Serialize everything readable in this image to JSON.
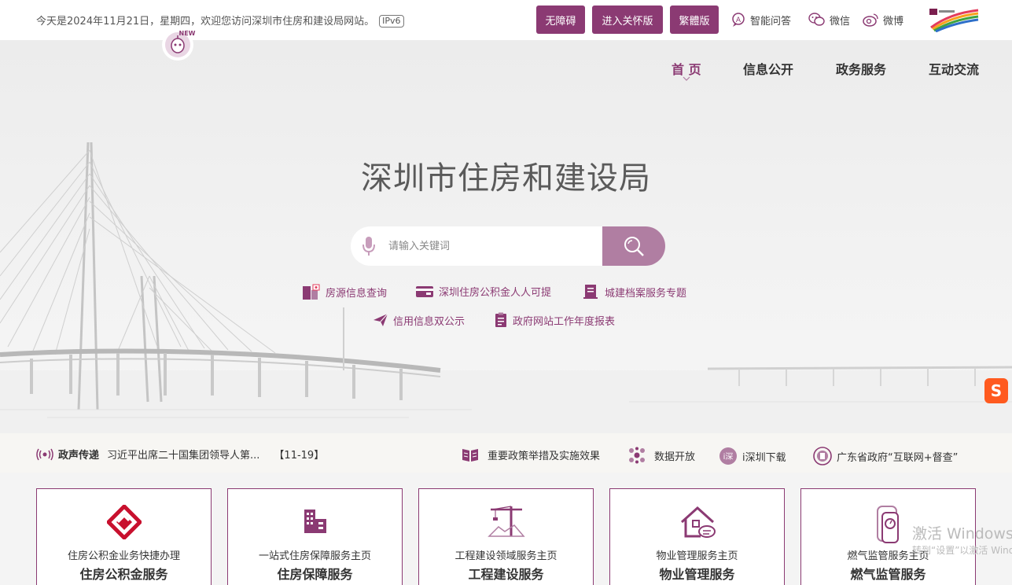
{
  "topbar": {
    "welcome": "今天是2024年11月21日，星期四，欢迎您访问深圳市住房和建设局网站。",
    "ipv6": "IPv6",
    "buttons": [
      "无障碍",
      "进入关怀版",
      "繁體版"
    ],
    "links": [
      "智能问答",
      "微信",
      "微博"
    ],
    "robot_badge": "NEW"
  },
  "nav": {
    "items": [
      "首 页",
      "信息公开",
      "政务服务",
      "互动交流"
    ]
  },
  "hero": {
    "title": "深圳市住房和建设局",
    "search_placeholder": "请输入关键词",
    "quick_links": [
      "房源信息查询",
      "深圳住房公积金人人可提",
      "城建档案服务专题",
      "信用信息双公示",
      "政府网站工作年度报表"
    ]
  },
  "strip": {
    "label": "政声传递",
    "headline": "习近平出席二十国集团领导人第...",
    "date": "【11-19】",
    "links": [
      "重要政策举措及实施效果",
      "数据开放",
      "i深圳下载",
      "广东省政府“互联网+督查”"
    ],
    "isz_icon_text": "i深"
  },
  "cards": [
    {
      "sub": "住房公积金业务快捷办理",
      "title": "住房公积金服务"
    },
    {
      "sub": "一站式住房保障服务主页",
      "title": "住房保障服务"
    },
    {
      "sub": "工程建设领域服务主页",
      "title": "工程建设服务"
    },
    {
      "sub": "物业管理服务主页",
      "title": "物业管理服务"
    },
    {
      "sub": "燃气监管服务主页",
      "title": "燃气监管服务"
    }
  ],
  "overlay": {
    "sogou": "S",
    "watermark_title": "激活 Windows",
    "watermark_sub": "转到“设置”以激活 Windows。"
  },
  "colors": {
    "accent": "#8b3a73",
    "search_button": "#b07ea2"
  }
}
